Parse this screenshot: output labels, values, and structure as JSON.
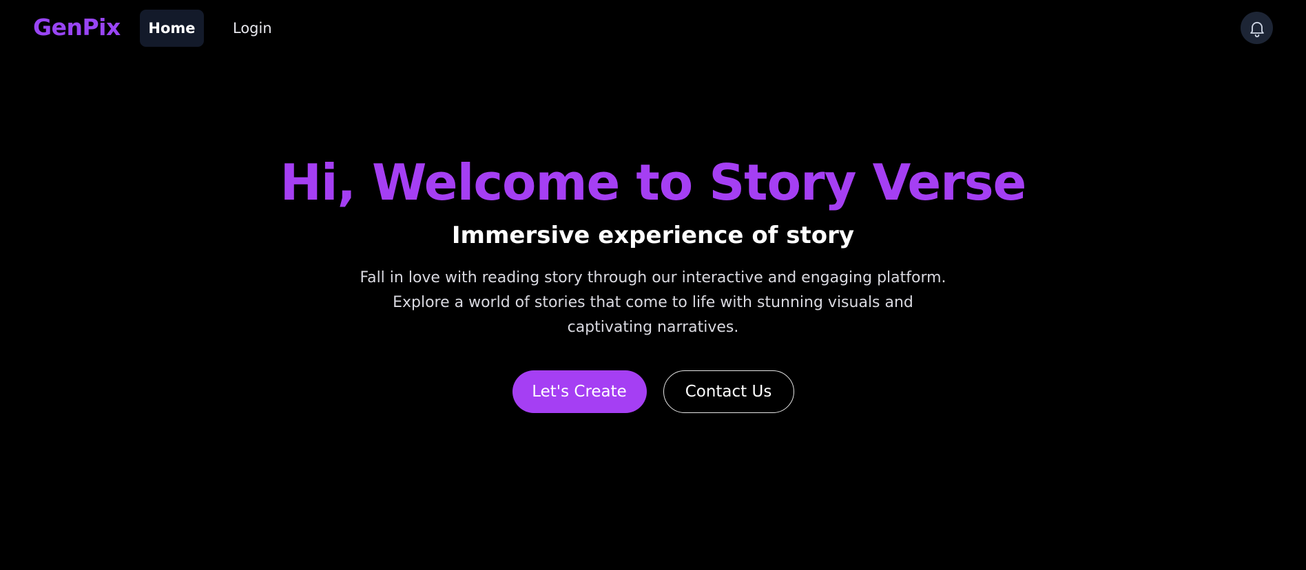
{
  "navbar": {
    "brand": "GenPix",
    "links": [
      {
        "label": "Home",
        "active": true
      },
      {
        "label": "Login",
        "active": false
      }
    ],
    "notification_icon": "bell-icon"
  },
  "hero": {
    "title": "Hi, Welcome to Story Verse",
    "subtitle": "Immersive experience of story",
    "description": "Fall in love with reading story through our interactive and engaging platform. Explore a world of stories that come to life with stunning visuals and captivating narratives.",
    "primary_button": "Let's Create",
    "secondary_button": "Contact Us"
  },
  "colors": {
    "background": "#000000",
    "accent": "#a53ff3",
    "nav_active_bg": "#131a2a"
  }
}
